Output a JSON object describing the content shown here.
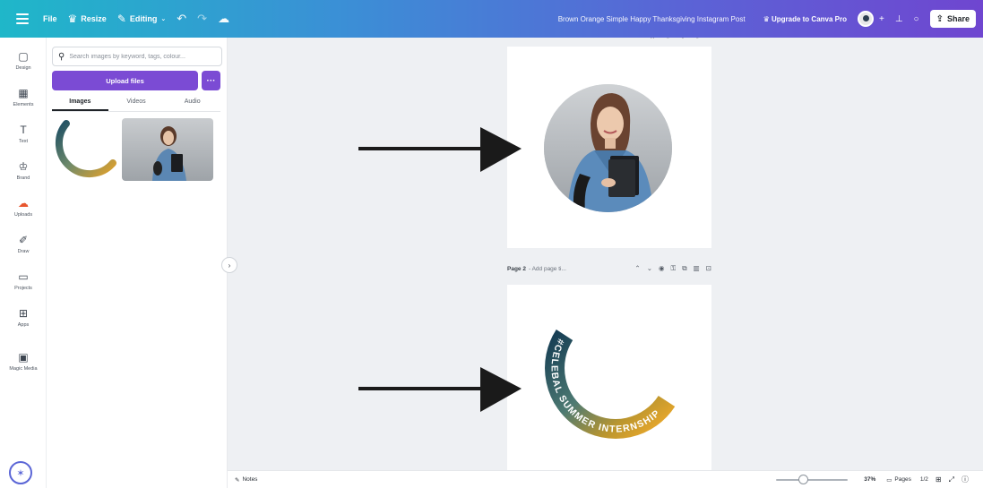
{
  "topbar": {
    "file_label": "File",
    "resize_label": "Resize",
    "editing_label": "Editing",
    "doc_title": "Brown Orange Simple Happy Thanksgiving Instagram Post",
    "upgrade_label": "Upgrade to Canva Pro",
    "share_label": "Share"
  },
  "rail": {
    "items": [
      {
        "label": "Design",
        "icon": "layout-icon"
      },
      {
        "label": "Elements",
        "icon": "shapes-icon"
      },
      {
        "label": "Text",
        "icon": "text-icon"
      },
      {
        "label": "Brand",
        "icon": "brand-icon"
      },
      {
        "label": "Uploads",
        "icon": "upload-icon"
      },
      {
        "label": "Draw",
        "icon": "draw-icon"
      },
      {
        "label": "Projects",
        "icon": "folder-icon"
      },
      {
        "label": "Apps",
        "icon": "apps-icon"
      },
      {
        "label": "Magic Media",
        "icon": "magic-icon"
      }
    ]
  },
  "panel": {
    "search_placeholder": "Search images by keyword, tags, colour...",
    "upload_label": "Upload files",
    "more_label": "···",
    "tabs": [
      {
        "label": "Images"
      },
      {
        "label": "Videos"
      },
      {
        "label": "Audio"
      }
    ]
  },
  "ring": {
    "text": "#CELEBAL SUMMER INTERNSHIP"
  },
  "page2_header": {
    "title": "Page 2",
    "subtitle": "- Add page ti..."
  },
  "bottombar": {
    "notes_label": "Notes",
    "zoom_value": 0.37,
    "zoom_label": "37%",
    "pages_label": "Pages",
    "page_count": "1/2"
  },
  "colors": {
    "topbar_start": "#1fb7c9",
    "topbar_end": "#6f46d0",
    "upload_button": "#7b4bd4",
    "ring_dark": "#1f4f64",
    "ring_light": "#e0a12c"
  }
}
